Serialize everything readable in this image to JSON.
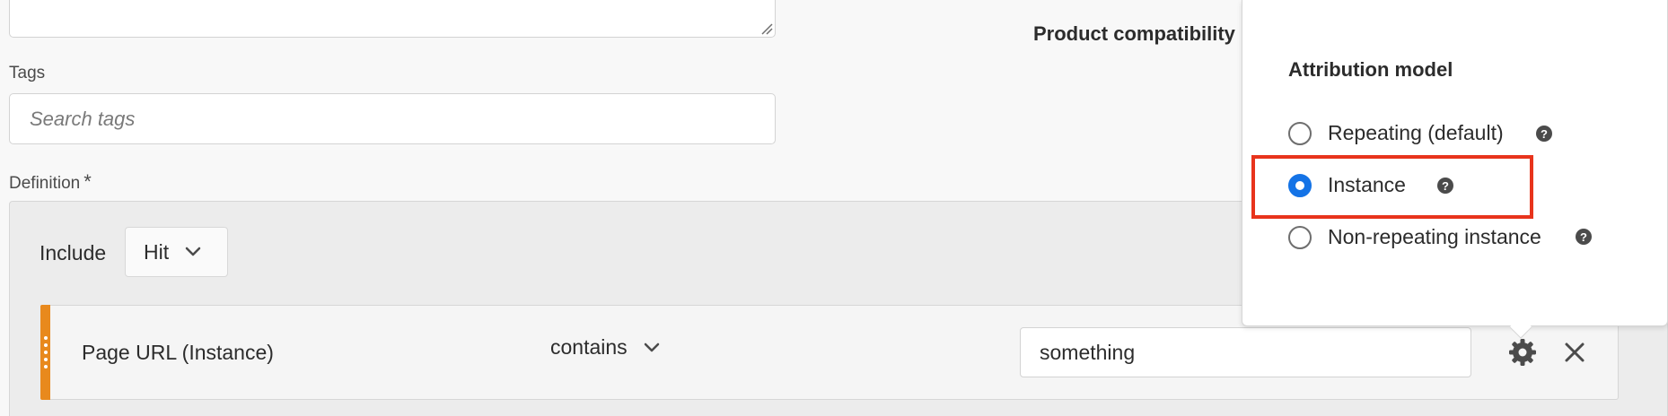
{
  "form": {
    "tags_label": "Tags",
    "tags_placeholder": "Search tags",
    "definition_label": "Definition",
    "required_mark": "*",
    "product_compatibility": "Product compatibility"
  },
  "definition": {
    "include_label": "Include",
    "container_selected": "Hit",
    "rule": {
      "dimension": "Page URL (Instance)",
      "operator": "contains",
      "value": "something"
    }
  },
  "popover": {
    "title": "Attribution model",
    "options": [
      {
        "label": "Repeating (default)",
        "selected": false
      },
      {
        "label": "Instance",
        "selected": true
      },
      {
        "label": "Non-repeating instance",
        "selected": false
      }
    ],
    "help_glyph": "?"
  },
  "colors": {
    "accent_blue": "#1473e6",
    "highlight_red": "#e8341c",
    "drag_handle_orange": "#e8891d"
  },
  "icons": {
    "operator_dropdown": "chevron-down-icon",
    "container_dropdown": "chevron-down-icon",
    "settings": "gear-icon",
    "remove": "close-icon",
    "help": "help-icon",
    "textarea_resize": "resize-grip-icon"
  }
}
